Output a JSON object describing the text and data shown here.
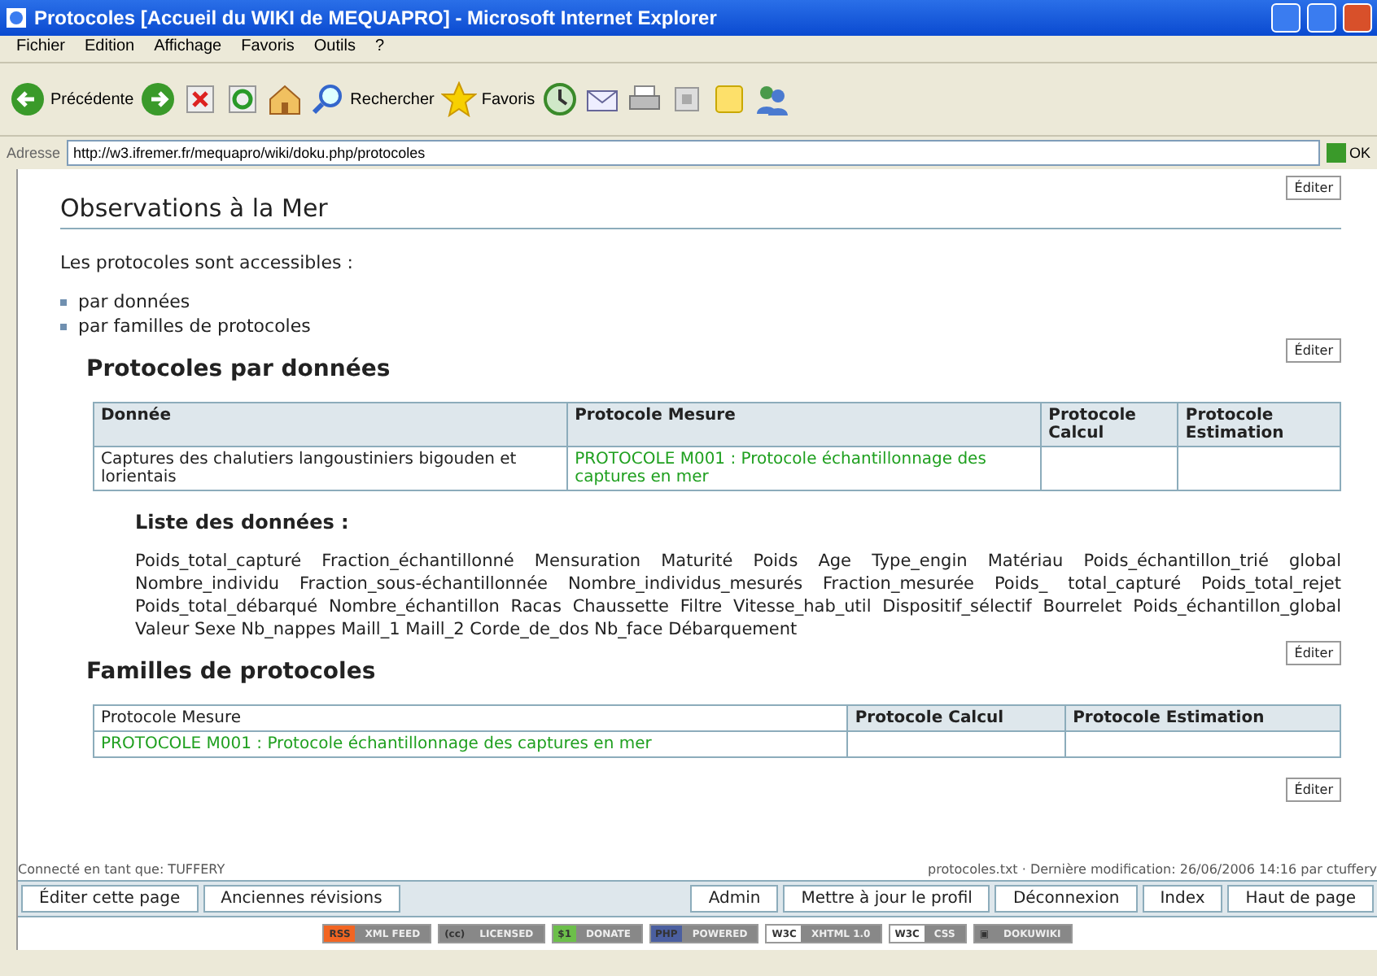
{
  "window": {
    "title": "Protocoles [Accueil du WIKI de MEQUAPRO] - Microsoft Internet Explorer"
  },
  "menu": [
    "Fichier",
    "Edition",
    "Affichage",
    "Favoris",
    "Outils",
    "?"
  ],
  "toolbar": [
    {
      "kind": "back",
      "label": "Précédente"
    },
    {
      "kind": "forward"
    },
    {
      "kind": "stop"
    },
    {
      "kind": "refresh"
    },
    {
      "kind": "home"
    },
    {
      "kind": "search",
      "label": "Rechercher"
    },
    {
      "kind": "favorites",
      "label": "Favoris"
    },
    {
      "kind": "history"
    },
    {
      "kind": "mail"
    },
    {
      "kind": "print"
    },
    {
      "kind": "edit"
    },
    {
      "kind": "notes"
    },
    {
      "kind": "messenger"
    }
  ],
  "address": {
    "label": "Adresse",
    "url": "http://w3.ifremer.fr/mequapro/wiki/doku.php/protocoles",
    "go": "OK"
  },
  "page": {
    "edit_buttons": [
      "Éditer",
      "Éditer",
      "Éditer",
      "Éditer"
    ],
    "title": "Observations à la Mer",
    "intro": "Les protocoles sont accessibles :",
    "links": [
      "par données",
      "par familles de protocoles"
    ],
    "section1": {
      "heading": "Protocoles par données",
      "table": {
        "columns": [
          "Donnée",
          "Protocole Mesure",
          "Protocole Calcul",
          "Protocole Estimation"
        ],
        "rows": [
          [
            "Captures des chalutiers langoustiniers bigouden et lorientais",
            "PROTOCOLE M001 : Protocole échantillonnage des captures en mer",
            "",
            ""
          ]
        ]
      }
    },
    "list_heading": "Liste des données :",
    "list_text": "Poids_total_capturé Fraction_échantillonné Mensuration Maturité Poids Age Type_engin Matériau Poids_échantillon_trié global Nombre_individu Fraction_sous-échantillonnée Nombre_individus_mesurés Fraction_mesurée Poids_ total_capturé Poids_total_rejet Poids_total_débarqué Nombre_échantillon Racas Chaussette Filtre Vitesse_hab_util Dispositif_sélectif Bourrelet Poids_échantillon_global Valeur Sexe Nb_nappes Maill_1 Maill_2 Corde_de_dos Nb_face Débarquement",
    "section2": {
      "heading": "Familles de protocoles",
      "table": {
        "columns": [
          "Protocole Mesure",
          "Protocole Calcul",
          "Protocole Estimation"
        ],
        "rows": [
          [
            "PROTOCOLE M001 : Protocole échantillonnage des captures en mer",
            "",
            ""
          ]
        ]
      }
    }
  },
  "footer": {
    "user": "Connecté en tant que: TUFFERY",
    "info": "protocoles.txt · Dernière modification: 26/06/2006 14:16 par ctuffery",
    "left_buttons": [
      "Éditer cette page",
      "Anciennes révisions"
    ],
    "right_buttons": [
      "Admin",
      "Mettre à jour le profil",
      "Déconnexion",
      "Index",
      "Haut de page"
    ],
    "badges": [
      {
        "tag": "RSS",
        "text": "XML FEED",
        "color": "#f26522"
      },
      {
        "tag": "(cc)",
        "text": "LICENSED",
        "color": "#888888"
      },
      {
        "tag": "$1",
        "text": "DONATE",
        "color": "#6cbf4a"
      },
      {
        "tag": "PHP",
        "text": "POWERED",
        "color": "#4b5fa0"
      },
      {
        "tag": "W3C",
        "text": "XHTML 1.0",
        "color": "#ffffff"
      },
      {
        "tag": "W3C",
        "text": "CSS",
        "color": "#ffffff"
      },
      {
        "tag": "▣",
        "text": "DOKUWIKI",
        "color": "#888888"
      }
    ]
  }
}
